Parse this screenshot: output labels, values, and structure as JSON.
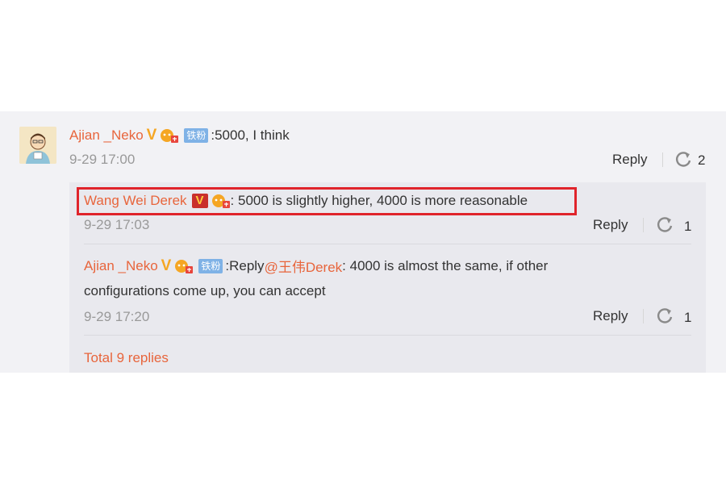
{
  "comment": {
    "author": "Ajian _Neko",
    "vip_badge": "V",
    "fan_badge": "铁粉",
    "text": ":5000, I think",
    "time": "9-29 17:00",
    "reply_label": "Reply",
    "repost_count": "2"
  },
  "replies": [
    {
      "author": "Wang Wei Derek",
      "vip_badge": "V",
      "text": ": 5000 is slightly higher, 4000 is more reasonable",
      "time": "9-29 17:03",
      "reply_label": "Reply",
      "repost_count": "1",
      "highlighted": true
    },
    {
      "author": "Ajian _Neko",
      "vip_badge": "V",
      "fan_badge": "铁粉",
      "text_prefix": ":Reply ",
      "mention": "@王伟Derek",
      "text_line1": " : 4000 is almost the same, if other",
      "text_line2": "configurations come up, you can accept",
      "time": "9-29 17:20",
      "reply_label": "Reply",
      "repost_count": "1"
    }
  ],
  "total_replies": "Total 9 replies",
  "colors": {
    "name": "#e8653c",
    "highlight_border": "#e0242b",
    "panel_bg": "#f2f2f5",
    "subpanel_bg": "#e9e9ee"
  },
  "icons": [
    "avatar",
    "vip-v-icon",
    "crown-icon",
    "fan-badge",
    "repost-icon"
  ]
}
